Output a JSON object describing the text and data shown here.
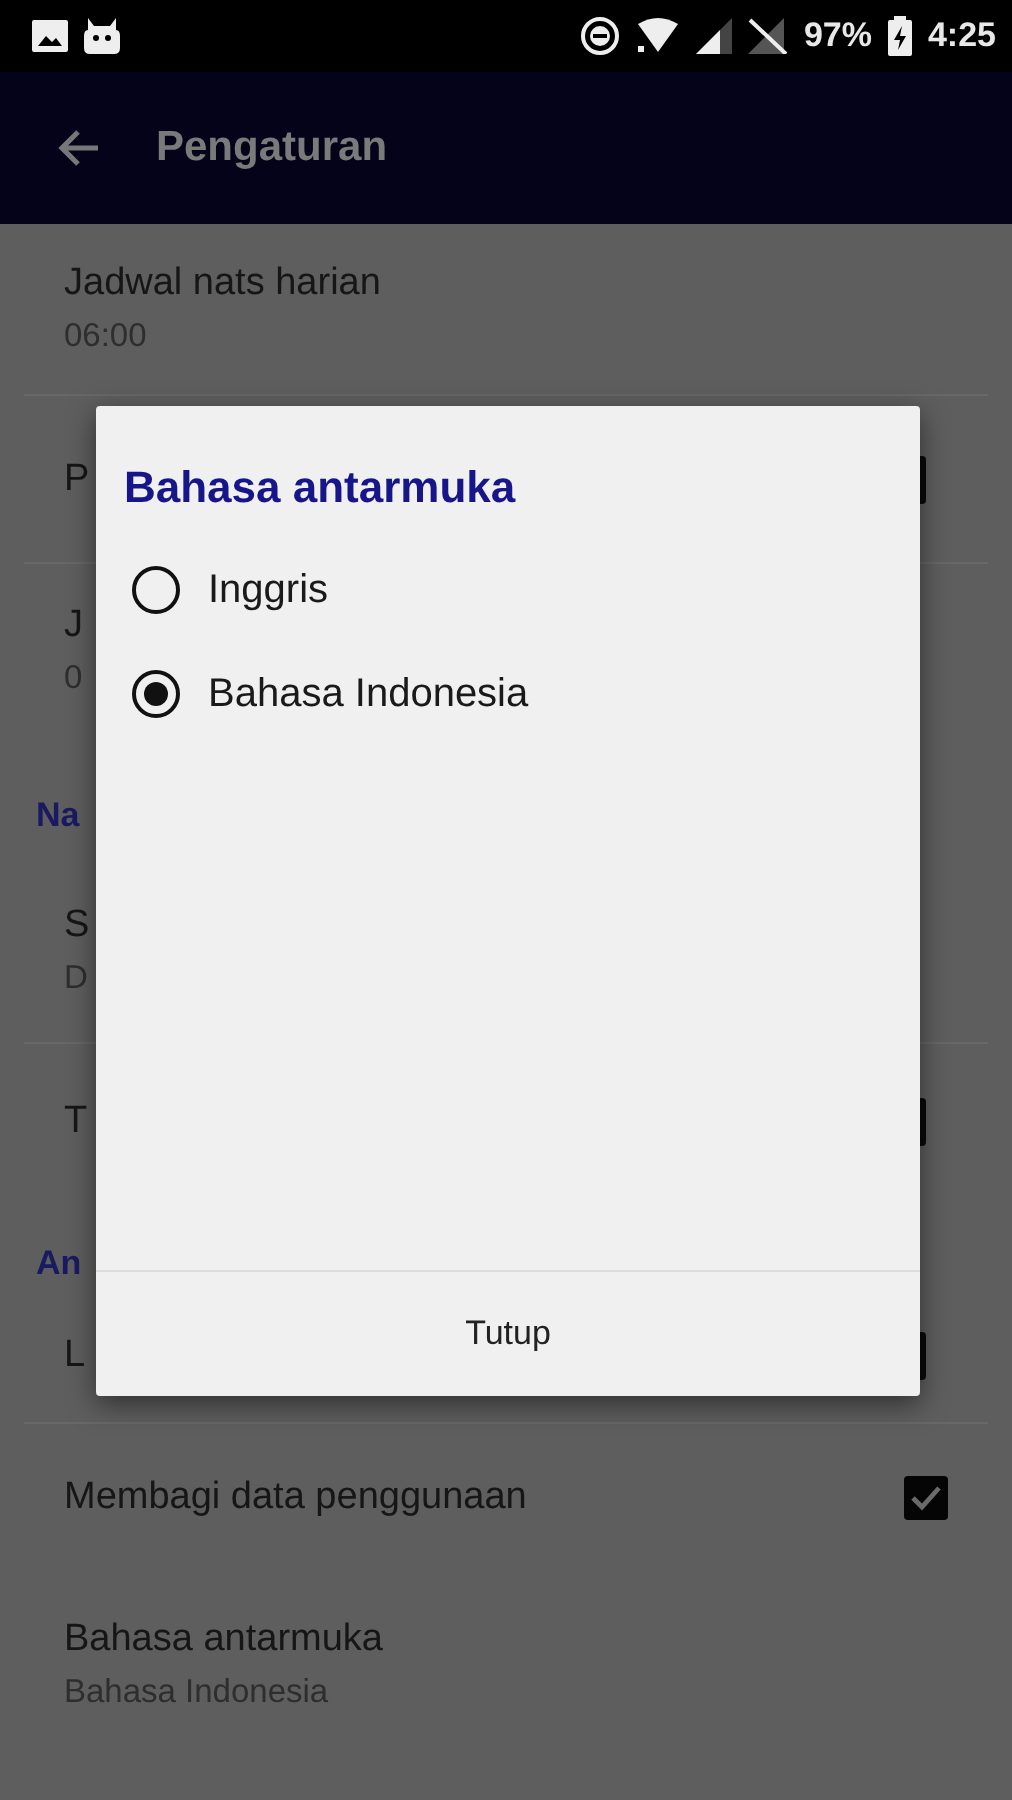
{
  "status_bar": {
    "battery": "97%",
    "time": "4:25"
  },
  "app_bar": {
    "title": "Pengaturan"
  },
  "settings": [
    {
      "kind": "item",
      "title": "Jadwal nats harian",
      "subtitle": "06:00"
    },
    {
      "kind": "item",
      "title": "P",
      "has_checkbox": true
    },
    {
      "kind": "item",
      "title": "J",
      "subtitle": "0"
    },
    {
      "kind": "header",
      "title": "Na"
    },
    {
      "kind": "item",
      "title": "S",
      "subtitle": "D"
    },
    {
      "kind": "item",
      "title": "T",
      "has_checkbox": true
    },
    {
      "kind": "header",
      "title": "An"
    },
    {
      "kind": "item",
      "title": "L",
      "has_checkbox": true
    },
    {
      "kind": "toggle",
      "title": "Membagi data penggunaan",
      "checked": true
    },
    {
      "kind": "item",
      "title": "Bahasa antarmuka",
      "subtitle": "Bahasa Indonesia"
    }
  ],
  "dialog": {
    "title": "Bahasa antarmuka",
    "options": [
      {
        "label": "Inggris",
        "selected": false
      },
      {
        "label": "Bahasa Indonesia",
        "selected": true
      }
    ],
    "button": "Tutup"
  }
}
